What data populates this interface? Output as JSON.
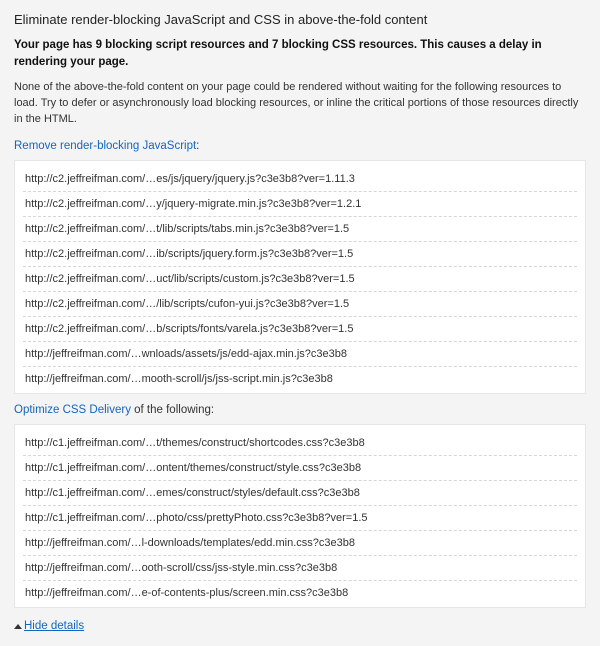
{
  "title": "Eliminate render-blocking JavaScript and CSS in above-the-fold content",
  "summary": "Your page has 9 blocking script resources and 7 blocking CSS resources. This causes a delay in rendering your page.",
  "explanation": "None of the above-the-fold content on your page could be rendered without waiting for the following resources to load. Try to defer or asynchronously load blocking resources, or inline the critical portions of those resources directly in the HTML.",
  "jsHeading": {
    "link": "Remove render-blocking JavaScript",
    "suffix": ":"
  },
  "jsResources": [
    "http://c2.jeffreifman.com/…es/js/jquery/jquery.js?c3e3b8?ver=1.11.3",
    "http://c2.jeffreifman.com/…y/jquery-migrate.min.js?c3e3b8?ver=1.2.1",
    "http://c2.jeffreifman.com/…t/lib/scripts/tabs.min.js?c3e3b8?ver=1.5",
    "http://c2.jeffreifman.com/…ib/scripts/jquery.form.js?c3e3b8?ver=1.5",
    "http://c2.jeffreifman.com/…uct/lib/scripts/custom.js?c3e3b8?ver=1.5",
    "http://c2.jeffreifman.com/…/lib/scripts/cufon-yui.js?c3e3b8?ver=1.5",
    "http://c2.jeffreifman.com/…b/scripts/fonts/varela.js?c3e3b8?ver=1.5",
    "http://jeffreifman.com/…wnloads/assets/js/edd-ajax.min.js?c3e3b8",
    "http://jeffreifman.com/…mooth-scroll/js/jss-script.min.js?c3e3b8"
  ],
  "cssHeading": {
    "link": "Optimize CSS Delivery",
    "suffix": " of the following:"
  },
  "cssResources": [
    "http://c1.jeffreifman.com/…t/themes/construct/shortcodes.css?c3e3b8",
    "http://c1.jeffreifman.com/…ontent/themes/construct/style.css?c3e3b8",
    "http://c1.jeffreifman.com/…emes/construct/styles/default.css?c3e3b8",
    "http://c1.jeffreifman.com/…photo/css/prettyPhoto.css?c3e3b8?ver=1.5",
    "http://jeffreifman.com/…l-downloads/templates/edd.min.css?c3e3b8",
    "http://jeffreifman.com/…ooth-scroll/css/jss-style.min.css?c3e3b8",
    "http://jeffreifman.com/…e-of-contents-plus/screen.min.css?c3e3b8"
  ],
  "hideDetails": "Hide details"
}
